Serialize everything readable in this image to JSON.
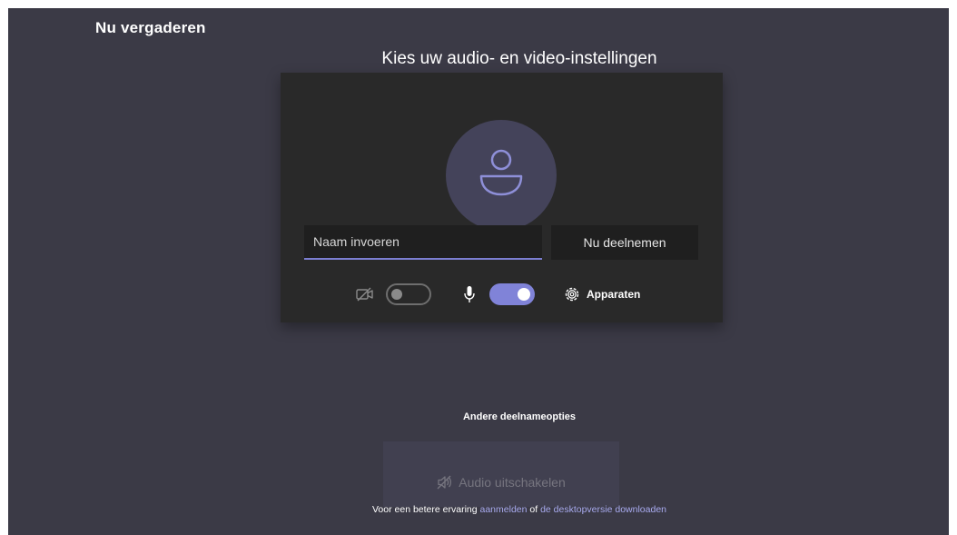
{
  "app": {
    "title": "Nu vergaderen"
  },
  "setup": {
    "heading": "Kies uw audio- en video-instellingen",
    "name_input": {
      "placeholder": "Naam invoeren",
      "value": ""
    },
    "join_label": "Nu deelnemen",
    "video_toggle": {
      "on": false
    },
    "mic_toggle": {
      "on": true
    },
    "devices_label": "Apparaten"
  },
  "other": {
    "heading": "Andere deelnameopties",
    "audio_off_label": "Audio uitschakelen"
  },
  "footer": {
    "prefix": "Voor een betere ervaring ",
    "signin_link": "aanmelden",
    "middle": " of ",
    "desktop_link": "de desktopversie downloaden"
  },
  "colors": {
    "background": "#3b3a46",
    "card": "#292929",
    "accent": "#8083d8",
    "link": "#a9abf0"
  },
  "icons": {
    "avatar": "person-icon",
    "video": "video-off-icon",
    "mic": "microphone-icon",
    "devices": "gear-icon",
    "audio_off": "speaker-off-icon"
  }
}
